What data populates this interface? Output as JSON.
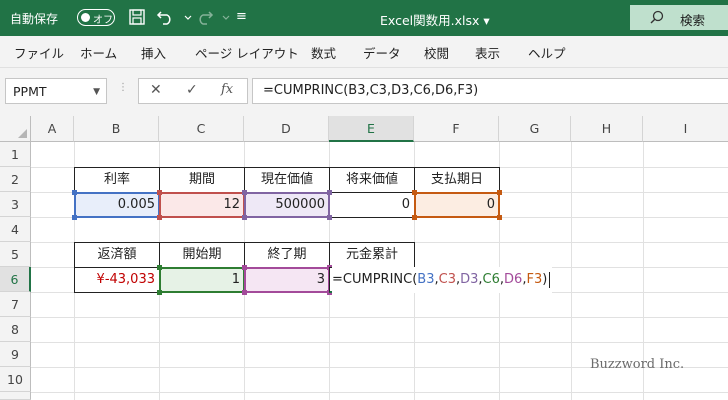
{
  "titlebar": {
    "autosave_label": "自動保存",
    "toggle_state": "オフ",
    "filename": "Excel関数用.xlsx",
    "filename_caret": "▾",
    "search_label": "検索",
    "qat_more": "≡"
  },
  "menu": [
    "ファイル",
    "ホーム",
    "挿入",
    "ページ レイアウト",
    "数式",
    "データ",
    "校閲",
    "表示",
    "ヘルプ"
  ],
  "formula_bar": {
    "name_box": "PPMT",
    "cancel": "✕",
    "enter": "✓",
    "fx": "fx",
    "formula": "=CUMPRINC(B3,C3,D3,C6,D6,F3)"
  },
  "grid": {
    "columns": [
      "A",
      "B",
      "C",
      "D",
      "E",
      "F",
      "G",
      "H",
      "I"
    ],
    "active_column": "E",
    "rows": [
      "1",
      "2",
      "3",
      "4",
      "5",
      "6",
      "7",
      "8",
      "9",
      "10",
      "11"
    ],
    "active_row": "6"
  },
  "cells": {
    "B2": "利率",
    "C2": "期間",
    "D2": "現在価値",
    "E2": "将来価値",
    "F2": "支払期日",
    "B3": "0.005",
    "C3": "12",
    "D3": "500000",
    "E3": "0",
    "F3": "0",
    "B5": "返済額",
    "C5": "開始期",
    "D5": "終了期",
    "E5": "元金累計",
    "B6": "¥-43,033",
    "C6": "1",
    "D6": "3"
  },
  "edit_formula": {
    "prefix": "=CUMPRINC(",
    "args": [
      "B3",
      "C3",
      "D3",
      "C6",
      "D6",
      "F3"
    ],
    "sep": ",",
    "suffix": ")"
  },
  "colors": {
    "excel_green": "#217346",
    "ref_B3": "#4472c4",
    "ref_C3": "#c0504d",
    "ref_D3": "#8064a2",
    "ref_C6": "#2e7d32",
    "ref_D6": "#a34a9a",
    "ref_F3": "#c55a11",
    "negative_value": "#c00000"
  },
  "watermark": "Buzzword Inc."
}
